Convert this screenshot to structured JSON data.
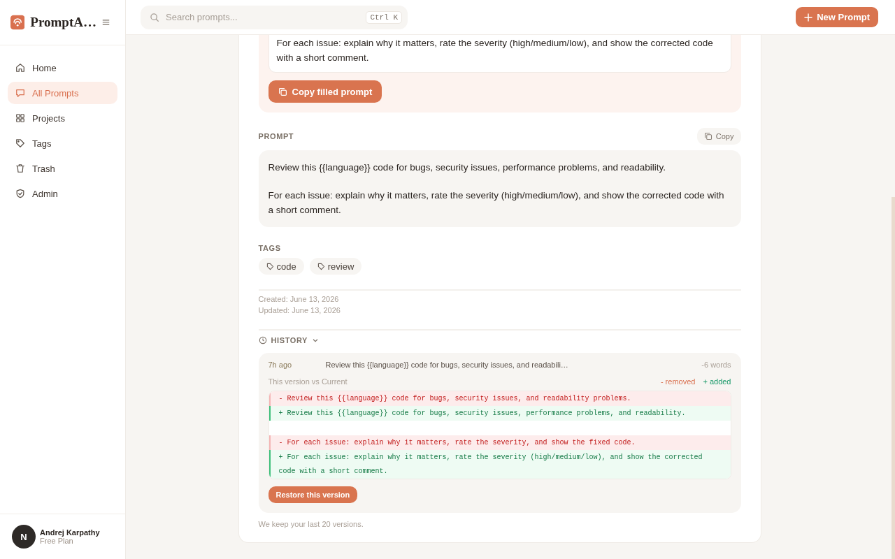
{
  "brand": {
    "name": "PromptA…"
  },
  "search": {
    "placeholder": "Search prompts...",
    "shortcut": "Ctrl K"
  },
  "new_button": {
    "label": "New Prompt"
  },
  "nav": [
    {
      "label": "Home",
      "selected": false
    },
    {
      "label": "All Prompts",
      "selected": true
    },
    {
      "label": "Projects",
      "selected": false
    },
    {
      "label": "Tags",
      "selected": false
    },
    {
      "label": "Trash",
      "selected": false
    },
    {
      "label": "Admin",
      "selected": false
    }
  ],
  "user": {
    "avatar": "N",
    "name": "Andrej Karpathy",
    "plan": "Free Plan"
  },
  "filled": {
    "text": "For each issue: explain why it matters, rate the severity (high/medium/low), and show the corrected code with a short comment.",
    "button": "Copy filled prompt"
  },
  "prompt": {
    "label": "PROMPT",
    "copy": "Copy",
    "paragraphs": [
      "Review this {{language}} code for bugs, security issues, performance problems, and readability.",
      "For each issue: explain why it matters, rate the severity (high/medium/low), and show the corrected code with a short comment."
    ]
  },
  "tags": {
    "label": "TAGS",
    "items": [
      "code",
      "review"
    ]
  },
  "meta": [
    "Created: June 13, 2026",
    "Updated: June 13, 2026"
  ],
  "history": {
    "label": "HISTORY",
    "expanded": true,
    "entry": {
      "time": "7h ago",
      "summary": "Review this {{language}} code for bugs, security issues, and readabili…",
      "delta": "-6 words",
      "compare": "This version vs Current",
      "removed_legend": "- removed",
      "added_legend": "+ added",
      "diff": [
        {
          "kind": "removed",
          "text": "- Review this {{language}} code for bugs, security issues, and readability problems."
        },
        {
          "kind": "added",
          "text": "+ Review this {{language}} code for bugs, security issues, performance problems, and readability."
        },
        {
          "kind": "blank"
        },
        {
          "kind": "removed",
          "text": "- For each issue: explain why it matters, rate the severity, and show the fixed code."
        },
        {
          "kind": "added",
          "text": "+ For each issue: explain why it matters, rate the severity (high/medium/low), and show the corrected code with a short comment."
        }
      ],
      "restore": "Restore this version"
    },
    "note": "We keep your last 20 versions."
  }
}
